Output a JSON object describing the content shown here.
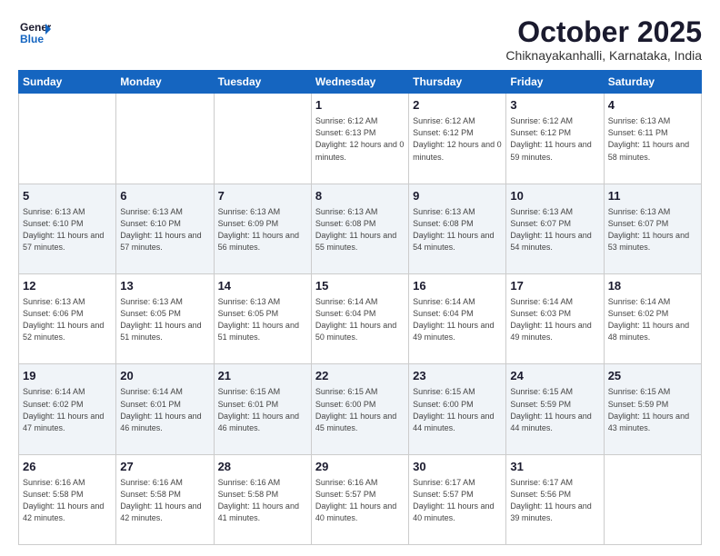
{
  "header": {
    "logo_line1": "General",
    "logo_line2": "Blue",
    "month": "October 2025",
    "location": "Chiknayakanhalli, Karnataka, India"
  },
  "weekdays": [
    "Sunday",
    "Monday",
    "Tuesday",
    "Wednesday",
    "Thursday",
    "Friday",
    "Saturday"
  ],
  "weeks": [
    [
      {
        "day": "",
        "info": ""
      },
      {
        "day": "",
        "info": ""
      },
      {
        "day": "",
        "info": ""
      },
      {
        "day": "1",
        "info": "Sunrise: 6:12 AM\nSunset: 6:13 PM\nDaylight: 12 hours\nand 0 minutes."
      },
      {
        "day": "2",
        "info": "Sunrise: 6:12 AM\nSunset: 6:12 PM\nDaylight: 12 hours\nand 0 minutes."
      },
      {
        "day": "3",
        "info": "Sunrise: 6:12 AM\nSunset: 6:12 PM\nDaylight: 11 hours\nand 59 minutes."
      },
      {
        "day": "4",
        "info": "Sunrise: 6:13 AM\nSunset: 6:11 PM\nDaylight: 11 hours\nand 58 minutes."
      }
    ],
    [
      {
        "day": "5",
        "info": "Sunrise: 6:13 AM\nSunset: 6:10 PM\nDaylight: 11 hours\nand 57 minutes."
      },
      {
        "day": "6",
        "info": "Sunrise: 6:13 AM\nSunset: 6:10 PM\nDaylight: 11 hours\nand 57 minutes."
      },
      {
        "day": "7",
        "info": "Sunrise: 6:13 AM\nSunset: 6:09 PM\nDaylight: 11 hours\nand 56 minutes."
      },
      {
        "day": "8",
        "info": "Sunrise: 6:13 AM\nSunset: 6:08 PM\nDaylight: 11 hours\nand 55 minutes."
      },
      {
        "day": "9",
        "info": "Sunrise: 6:13 AM\nSunset: 6:08 PM\nDaylight: 11 hours\nand 54 minutes."
      },
      {
        "day": "10",
        "info": "Sunrise: 6:13 AM\nSunset: 6:07 PM\nDaylight: 11 hours\nand 54 minutes."
      },
      {
        "day": "11",
        "info": "Sunrise: 6:13 AM\nSunset: 6:07 PM\nDaylight: 11 hours\nand 53 minutes."
      }
    ],
    [
      {
        "day": "12",
        "info": "Sunrise: 6:13 AM\nSunset: 6:06 PM\nDaylight: 11 hours\nand 52 minutes."
      },
      {
        "day": "13",
        "info": "Sunrise: 6:13 AM\nSunset: 6:05 PM\nDaylight: 11 hours\nand 51 minutes."
      },
      {
        "day": "14",
        "info": "Sunrise: 6:13 AM\nSunset: 6:05 PM\nDaylight: 11 hours\nand 51 minutes."
      },
      {
        "day": "15",
        "info": "Sunrise: 6:14 AM\nSunset: 6:04 PM\nDaylight: 11 hours\nand 50 minutes."
      },
      {
        "day": "16",
        "info": "Sunrise: 6:14 AM\nSunset: 6:04 PM\nDaylight: 11 hours\nand 49 minutes."
      },
      {
        "day": "17",
        "info": "Sunrise: 6:14 AM\nSunset: 6:03 PM\nDaylight: 11 hours\nand 49 minutes."
      },
      {
        "day": "18",
        "info": "Sunrise: 6:14 AM\nSunset: 6:02 PM\nDaylight: 11 hours\nand 48 minutes."
      }
    ],
    [
      {
        "day": "19",
        "info": "Sunrise: 6:14 AM\nSunset: 6:02 PM\nDaylight: 11 hours\nand 47 minutes."
      },
      {
        "day": "20",
        "info": "Sunrise: 6:14 AM\nSunset: 6:01 PM\nDaylight: 11 hours\nand 46 minutes."
      },
      {
        "day": "21",
        "info": "Sunrise: 6:15 AM\nSunset: 6:01 PM\nDaylight: 11 hours\nand 46 minutes."
      },
      {
        "day": "22",
        "info": "Sunrise: 6:15 AM\nSunset: 6:00 PM\nDaylight: 11 hours\nand 45 minutes."
      },
      {
        "day": "23",
        "info": "Sunrise: 6:15 AM\nSunset: 6:00 PM\nDaylight: 11 hours\nand 44 minutes."
      },
      {
        "day": "24",
        "info": "Sunrise: 6:15 AM\nSunset: 5:59 PM\nDaylight: 11 hours\nand 44 minutes."
      },
      {
        "day": "25",
        "info": "Sunrise: 6:15 AM\nSunset: 5:59 PM\nDaylight: 11 hours\nand 43 minutes."
      }
    ],
    [
      {
        "day": "26",
        "info": "Sunrise: 6:16 AM\nSunset: 5:58 PM\nDaylight: 11 hours\nand 42 minutes."
      },
      {
        "day": "27",
        "info": "Sunrise: 6:16 AM\nSunset: 5:58 PM\nDaylight: 11 hours\nand 42 minutes."
      },
      {
        "day": "28",
        "info": "Sunrise: 6:16 AM\nSunset: 5:58 PM\nDaylight: 11 hours\nand 41 minutes."
      },
      {
        "day": "29",
        "info": "Sunrise: 6:16 AM\nSunset: 5:57 PM\nDaylight: 11 hours\nand 40 minutes."
      },
      {
        "day": "30",
        "info": "Sunrise: 6:17 AM\nSunset: 5:57 PM\nDaylight: 11 hours\nand 40 minutes."
      },
      {
        "day": "31",
        "info": "Sunrise: 6:17 AM\nSunset: 5:56 PM\nDaylight: 11 hours\nand 39 minutes."
      },
      {
        "day": "",
        "info": ""
      }
    ]
  ]
}
